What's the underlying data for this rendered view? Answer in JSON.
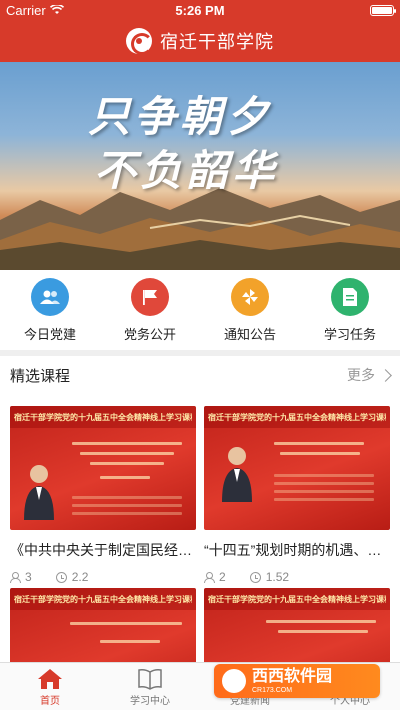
{
  "status_bar": {
    "carrier": "Carrier",
    "time": "5:26 PM"
  },
  "header": {
    "title": "宿迁干部学院"
  },
  "banner": {
    "slogan_line1": "只争朝夕",
    "slogan_line2": "不负韶华"
  },
  "quick_links": [
    {
      "label": "今日党建",
      "icon": "people-icon",
      "color": "#3a9be0"
    },
    {
      "label": "党务公开",
      "icon": "party-flag-icon",
      "color": "#e0483a"
    },
    {
      "label": "通知公告",
      "icon": "pinwheel-icon",
      "color": "#f2a22a"
    },
    {
      "label": "学习任务",
      "icon": "document-icon",
      "color": "#2fb36e"
    }
  ],
  "courses_section": {
    "title": "精选课程",
    "more_label": "更多"
  },
  "courses": [
    {
      "title": "《中共中央关于制定国民经…",
      "views": "3",
      "duration": "2.2",
      "thumb_title": "宿迁干部学院党的十九届五中全会精神线上学习课程"
    },
    {
      "title": "“十四五”规划时期的机遇、…",
      "views": "2",
      "duration": "1.52",
      "thumb_title": "宿迁干部学院党的十九届五中全会精神线上学习课程"
    },
    {
      "title": "",
      "views": "",
      "duration": "",
      "thumb_title": "宿迁干部学院党的十九届五中全会精神线上学习课程"
    },
    {
      "title": "",
      "views": "",
      "duration": "",
      "thumb_title": "宿迁干部学院党的十九届五中全会精神线上学习课程"
    }
  ],
  "tabbar": [
    {
      "label": "首页",
      "icon": "home-icon",
      "active": true
    },
    {
      "label": "学习中心",
      "icon": "book-icon",
      "active": false
    },
    {
      "label": "党建新闻",
      "icon": "news-icon",
      "active": false
    },
    {
      "label": "个人中心",
      "icon": "person-icon",
      "active": false
    }
  ],
  "watermark": {
    "name": "西西软件园",
    "url": "CR173.COM"
  },
  "colors": {
    "brand_red": "#d73a2a",
    "inactive_gray": "#777777"
  }
}
